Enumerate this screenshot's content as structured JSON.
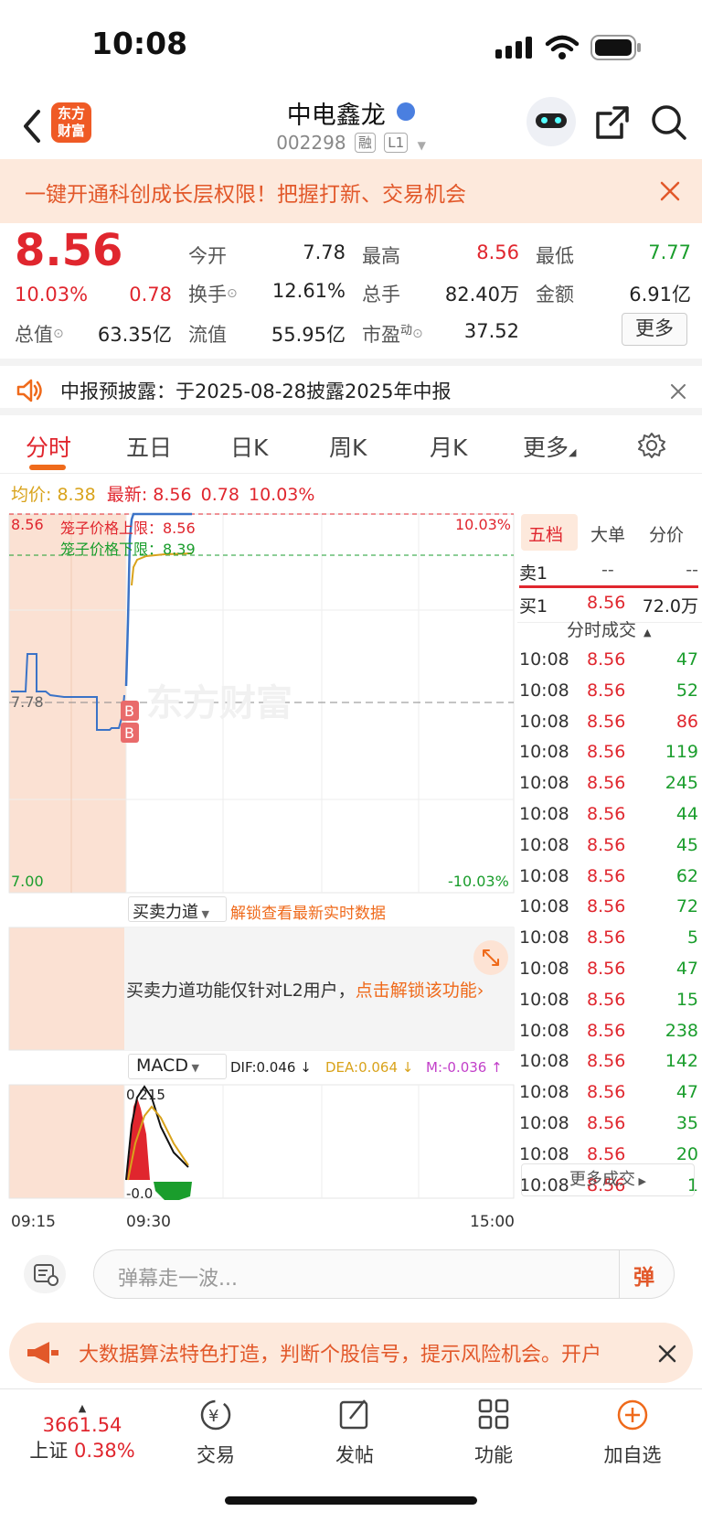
{
  "status_bar": {
    "time": "10:08"
  },
  "header": {
    "logo_text": "东方财富",
    "stock_name": "中电鑫龙",
    "stock_code": "002298",
    "tag1": "融",
    "tag2": "L1"
  },
  "promo": {
    "text": "一键开通科创成长层权限！把握打新、交易机会"
  },
  "quote": {
    "price": "8.56",
    "change_pct": "10.03%",
    "change": "0.78",
    "open_label": "今开",
    "open": "7.78",
    "high_label": "最高",
    "high": "8.56",
    "low_label": "最低",
    "low": "7.77",
    "turnover_label": "换手",
    "turnover": "12.61%",
    "volume_label": "总手",
    "volume": "82.40万",
    "amount_label": "金额",
    "amount": "6.91亿",
    "mktcap_label": "总值",
    "mktcap": "63.35亿",
    "float_label": "流值",
    "float_cap": "55.95亿",
    "pe_label": "市盈",
    "pe_sup": "动",
    "pe": "37.52",
    "more_label": "更多"
  },
  "notice": {
    "text": "中报预披露：于2025-08-28披露2025年中报"
  },
  "tabs": [
    "分时",
    "五日",
    "日K",
    "周K",
    "月K",
    "更多"
  ],
  "summary": {
    "avg_label": "均价:",
    "avg": "8.38",
    "latest_label": "最新:",
    "latest": "8.56",
    "chg": "0.78",
    "pct": "10.03%"
  },
  "chart": {
    "y_max": "8.56",
    "y_mid": "7.78",
    "y_min": "7.00",
    "pct_max": "10.03%",
    "pct_min": "-10.03%",
    "upper_limit_label": "笼子价格上限：8.56",
    "lower_limit_label": "笼子价格下限：8.39",
    "watermark": "东方财富",
    "b_marker": "B",
    "t_start": "09:15",
    "t_open": "09:30",
    "t_end": "15:00",
    "power_label": "买卖力道",
    "power_unlock": "解锁查看最新实时数据",
    "power_msg": "买卖力道功能仅针对L2用户，",
    "power_link": "点击解锁该功能",
    "macd_label": "MACD",
    "dif": "DIF:0.046 ↓",
    "dea": "DEA:0.064 ↓",
    "m": "M:-0.036 ↑",
    "macd_top": "0.215",
    "macd_bottom": "-0.0"
  },
  "chart_data": {
    "type": "line",
    "title": "",
    "x": [
      "09:15",
      "09:30",
      "15:00"
    ],
    "series": [
      {
        "name": "最新",
        "values": [
          7.78,
          8.56
        ]
      },
      {
        "name": "均价",
        "values": [
          8.38
        ]
      }
    ],
    "ylim": [
      7.0,
      8.56
    ],
    "ref_lines": {
      "upper_limit": 8.56,
      "lower_limit": 8.39,
      "prev_close": 7.78
    }
  },
  "right_panel": {
    "tabs": [
      "五档",
      "大单",
      "分价"
    ],
    "sell1_label": "卖1",
    "sell1_price": "--",
    "sell1_vol": "--",
    "buy1_label": "买1",
    "buy1_price": "8.56",
    "buy1_vol": "72.0万",
    "trades_title": "分时成交",
    "trades": [
      {
        "t": "10:08",
        "p": "8.56",
        "v": "47",
        "c": "green"
      },
      {
        "t": "10:08",
        "p": "8.56",
        "v": "52",
        "c": "green"
      },
      {
        "t": "10:08",
        "p": "8.56",
        "v": "86",
        "c": "red"
      },
      {
        "t": "10:08",
        "p": "8.56",
        "v": "119",
        "c": "green"
      },
      {
        "t": "10:08",
        "p": "8.56",
        "v": "245",
        "c": "green"
      },
      {
        "t": "10:08",
        "p": "8.56",
        "v": "44",
        "c": "green"
      },
      {
        "t": "10:08",
        "p": "8.56",
        "v": "45",
        "c": "green"
      },
      {
        "t": "10:08",
        "p": "8.56",
        "v": "62",
        "c": "green"
      },
      {
        "t": "10:08",
        "p": "8.56",
        "v": "72",
        "c": "green"
      },
      {
        "t": "10:08",
        "p": "8.56",
        "v": "5",
        "c": "green"
      },
      {
        "t": "10:08",
        "p": "8.56",
        "v": "47",
        "c": "green"
      },
      {
        "t": "10:08",
        "p": "8.56",
        "v": "15",
        "c": "green"
      },
      {
        "t": "10:08",
        "p": "8.56",
        "v": "238",
        "c": "green"
      },
      {
        "t": "10:08",
        "p": "8.56",
        "v": "142",
        "c": "green"
      },
      {
        "t": "10:08",
        "p": "8.56",
        "v": "47",
        "c": "green"
      },
      {
        "t": "10:08",
        "p": "8.56",
        "v": "35",
        "c": "green"
      },
      {
        "t": "10:08",
        "p": "8.56",
        "v": "20",
        "c": "green"
      },
      {
        "t": "10:08",
        "p": "8.56",
        "v": "1",
        "c": "green"
      }
    ],
    "more_trades": "更多成交"
  },
  "comment": {
    "placeholder": "弹幕走一波...",
    "danmu": "弹"
  },
  "ad": {
    "text": "大数据算法特色打造，判断个股信号，提示风险机会。开户"
  },
  "bottom_nav": {
    "index_value": "3661.54",
    "index_name": "上证",
    "index_pct": "0.38%",
    "trade": "交易",
    "post": "发帖",
    "func": "功能",
    "add": "加自选"
  }
}
